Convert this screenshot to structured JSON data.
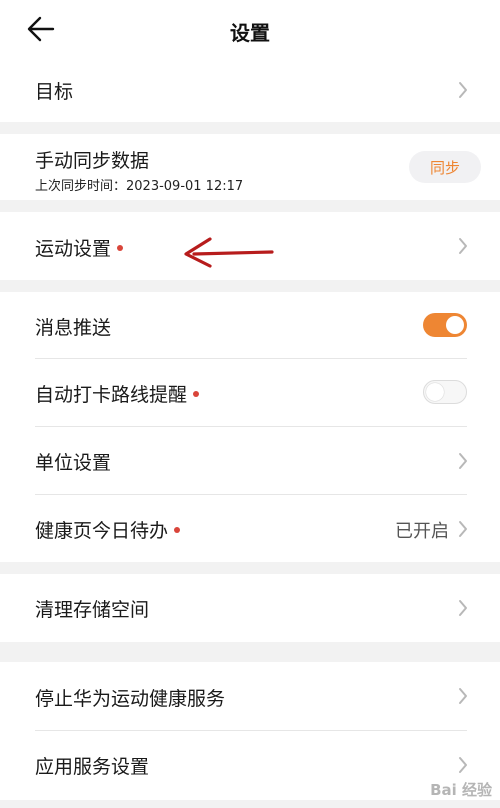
{
  "colors": {
    "accent": "#ee8633",
    "badge_dot": "#d9453a",
    "annotation_arrow": "#b71c1c"
  },
  "header": {
    "title": "设置",
    "back_icon": "arrow-left-icon"
  },
  "rows": {
    "goal": {
      "label": "目标"
    },
    "manual_sync": {
      "label": "手动同步数据",
      "last_sync": "上次同步时间：2023-09-01 12:17",
      "button_label": "同步"
    },
    "exercise_settings": {
      "label": "运动设置"
    },
    "push_notifications": {
      "label": "消息推送",
      "enabled": true
    },
    "auto_checkin_reminder": {
      "label": "自动打卡路线提醒",
      "enabled": false
    },
    "unit_settings": {
      "label": "单位设置"
    },
    "health_todo": {
      "label": "健康页今日待办",
      "value": "已开启"
    },
    "clear_storage": {
      "label": "清理存储空间"
    },
    "stop_service": {
      "label": "停止华为运动健康服务"
    },
    "app_service_settings": {
      "label": "应用服务设置"
    }
  },
  "watermark": {
    "text": "Bai 经验"
  }
}
